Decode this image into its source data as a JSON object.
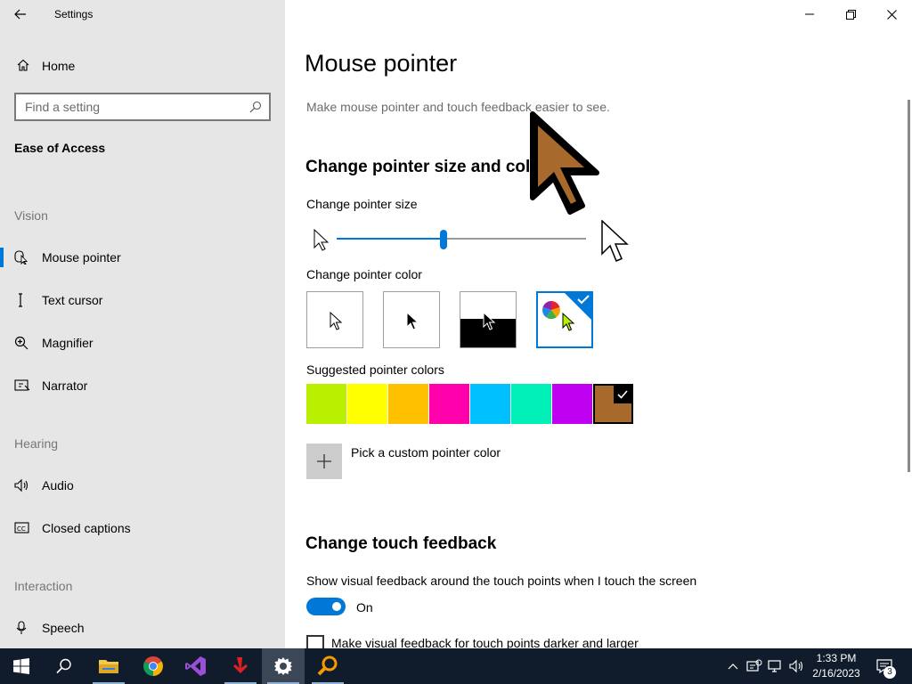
{
  "window": {
    "app_title": "Settings",
    "back_icon": "arrow-left-icon",
    "minimize_icon": "minimize-icon",
    "restore_icon": "restore-icon",
    "close_icon": "close-icon"
  },
  "sidebar": {
    "home_label": "Home",
    "search_placeholder": "Find a setting",
    "section_title": "Ease of Access",
    "groups": [
      {
        "label": "Vision",
        "items": [
          {
            "label": "Mouse pointer",
            "icon": "mouse-pointer-icon",
            "selected": true
          },
          {
            "label": "Text cursor",
            "icon": "text-cursor-icon"
          },
          {
            "label": "Magnifier",
            "icon": "magnifier-icon"
          },
          {
            "label": "Narrator",
            "icon": "narrator-icon"
          }
        ]
      },
      {
        "label": "Hearing",
        "items": [
          {
            "label": "Audio",
            "icon": "speaker-icon"
          },
          {
            "label": "Closed captions",
            "icon": "closed-captions-icon"
          }
        ]
      },
      {
        "label": "Interaction",
        "items": [
          {
            "label": "Speech",
            "icon": "microphone-icon"
          }
        ]
      }
    ]
  },
  "main": {
    "title": "Mouse pointer",
    "description": "Make mouse pointer and touch feedback easier to see.",
    "size_section_heading": "Change pointer size and color",
    "size_label": "Change pointer size",
    "size_slider": {
      "value": 7,
      "min": 1,
      "max": 15
    },
    "color_label": "Change pointer color",
    "color_options": [
      {
        "name": "white",
        "selected": false
      },
      {
        "name": "black",
        "selected": false
      },
      {
        "name": "inverted",
        "selected": false
      },
      {
        "name": "custom",
        "selected": true
      }
    ],
    "suggested_label": "Suggested pointer colors",
    "suggested_colors": [
      "#b8f000",
      "#ffff00",
      "#ffc000",
      "#ff00aa",
      "#00c0ff",
      "#00f0b8",
      "#c000f0",
      "#a86a2c"
    ],
    "selected_suggested_index": 7,
    "custom_color_label": "Pick a custom pointer color",
    "touch_heading": "Change touch feedback",
    "touch_feedback_label": "Show visual feedback around the touch points when I touch the screen",
    "toggle_state": "On",
    "darker_label": "Make visual feedback for touch points darker and larger"
  },
  "overlay_pointer_color": "#a86a2c",
  "accent_color": "#0078d7",
  "taskbar": {
    "apps": [
      {
        "name": "start-button",
        "icon": "windows-logo-icon"
      },
      {
        "name": "search-button",
        "icon": "search-icon"
      },
      {
        "name": "file-explorer",
        "icon": "folder-icon"
      },
      {
        "name": "chrome",
        "icon": "chrome-icon"
      },
      {
        "name": "visual-studio",
        "icon": "visual-studio-icon"
      },
      {
        "name": "app-red",
        "icon": "red-app-icon"
      },
      {
        "name": "settings",
        "icon": "gear-icon",
        "active": true
      },
      {
        "name": "magnifier-app",
        "icon": "magnifier-app-icon"
      }
    ],
    "time": "1:33 PM",
    "date": "2/16/2023",
    "notification_count": "3"
  }
}
